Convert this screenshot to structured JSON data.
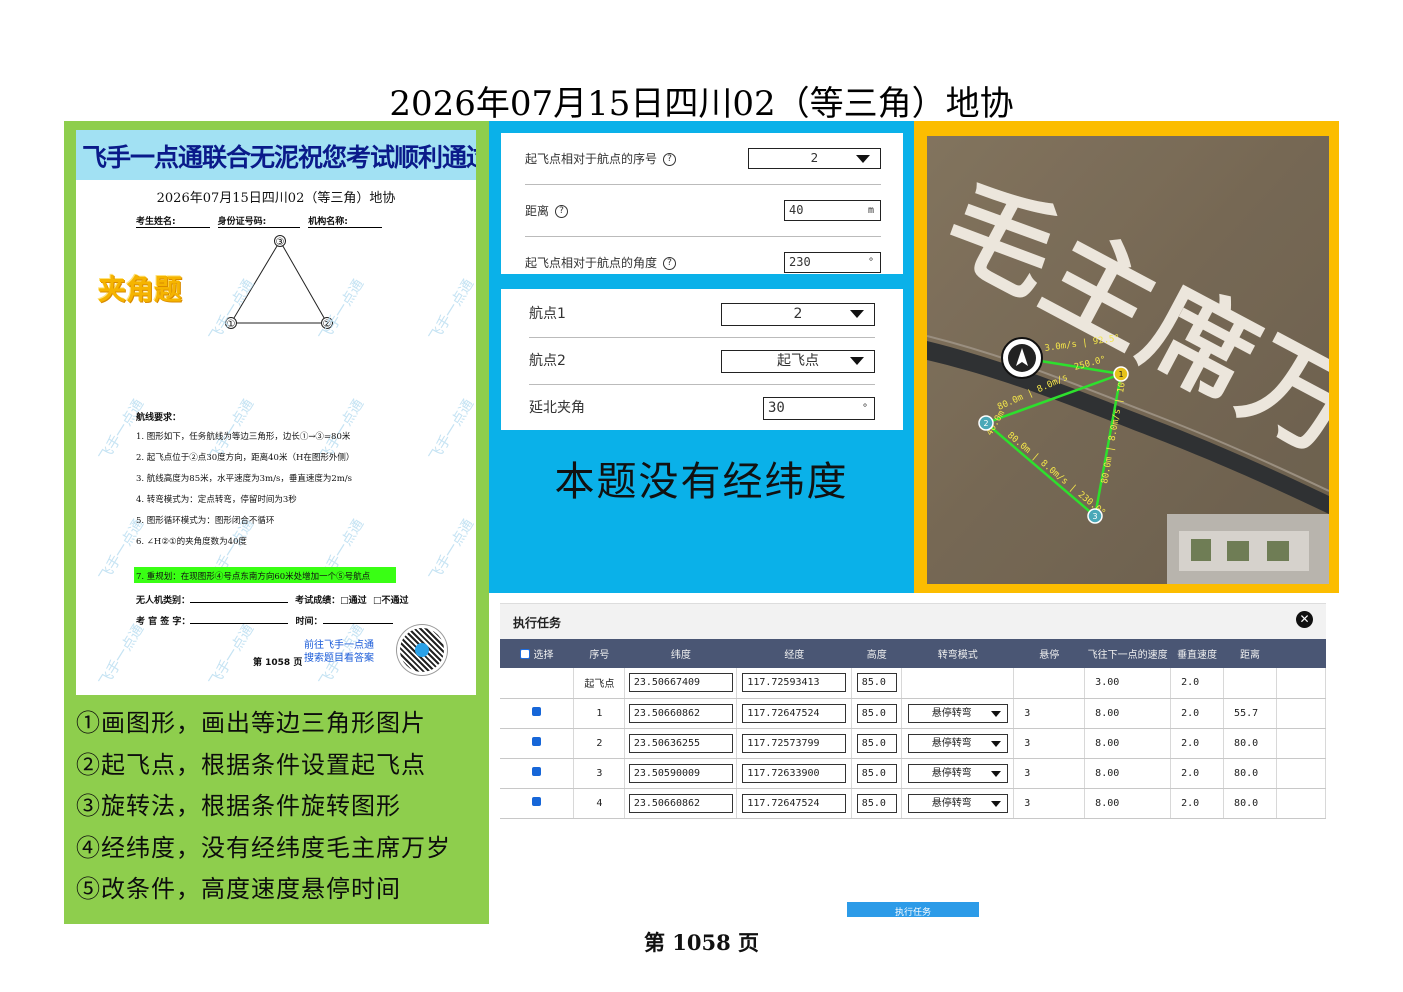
{
  "title": "2026年07月15日四川02（等三角）地协",
  "paper": {
    "banner": "飞手一点通联合无泥祝您考试顺利通过",
    "title": "2026年07月15日四川02（等三角）地协",
    "field_name": "考生姓名:",
    "field_id": "身份证号码:",
    "field_org": "机构名称:",
    "stamp": "夹角题",
    "tri_labels": [
      "③",
      "①",
      "②"
    ],
    "req_head": "航线要求：",
    "req": [
      "1.  图形如下，任务航线为等边三角形，边长①→③=80米",
      "2.  起飞点位于②点30度方向，距离40米（H在图形外侧）",
      "3.  航线高度为85米，水平速度为3m/s，垂直速度为2m/s",
      "4.  转弯模式为：定点转弯，停留时间为3秒",
      "5.  图形循环模式为：图形闭合不循环",
      "6.  ∠H②①的夹角度数为40度"
    ],
    "req_hl": "7.  重规划：在现图形④号点东南方向60米处增加一个⑤号航点",
    "uav_type": "无人机类别：",
    "result": "考试成绩：",
    "pass": "□通过",
    "fail": "□不通过",
    "examiner": "考 官 签 字：",
    "time": "时间：",
    "page": "第 1058 页",
    "goto1": "前往飞手一点通",
    "goto2": "搜索题目看答案",
    "watermark": "飞手一点通"
  },
  "steps": [
    "①画图形，画出等边三角形图片",
    "②起飞点，根据条件设置起飞点",
    "③旋转法，根据条件旋转图形",
    "④经纬度，没有经纬度毛主席万岁",
    "⑤改条件，高度速度悬停时间"
  ],
  "form1": {
    "seq_label": "起飞点相对于航点的序号",
    "seq_value": "2",
    "dist_label": "距离",
    "dist_value": "40",
    "dist_unit": "m",
    "angle_label": "起飞点相对于航点的角度",
    "angle_value": "230",
    "angle_unit": "°",
    "help": "?"
  },
  "form2": {
    "wp1_label": "航点1",
    "wp1_value": "2",
    "wp2_label": "航点2",
    "wp2_value": "起飞点",
    "north_label": "延北夹角",
    "north_value": "30",
    "north_unit": "°"
  },
  "no_latlon": "本题没有经纬度",
  "map": {
    "text": "毛主席万岁",
    "label_top": "3.0m/s | 92.5°",
    "label_a": "250.0°",
    "label_b": "80.0m | 8.0m/s",
    "label_c": "80.0m | 8.0m/s | 230.0°",
    "label_d": "40.0m",
    "label_e": "80.0m | 8.0m/s | 10.0°",
    "wp": [
      "1",
      "2",
      "3"
    ]
  },
  "task": {
    "title": "执行任务",
    "close": "✕",
    "headers": [
      "选择",
      "序号",
      "纬度",
      "经度",
      "高度",
      "转弯模式",
      "悬停",
      "飞往下一点的速度",
      "垂直速度",
      "距离"
    ],
    "rows": [
      {
        "seq": "起飞点",
        "lat": "23.50667409",
        "lon": "117.72593413",
        "alt": "85.0",
        "turn": "",
        "hover": "",
        "speed": "3.00",
        "vspeed": "2.0",
        "dist": ""
      },
      {
        "seq": "1",
        "lat": "23.50660862",
        "lon": "117.72647524",
        "alt": "85.0",
        "turn": "悬停转弯",
        "hover": "3",
        "speed": "8.00",
        "vspeed": "2.0",
        "dist": "55.7"
      },
      {
        "seq": "2",
        "lat": "23.50636255",
        "lon": "117.72573799",
        "alt": "85.0",
        "turn": "悬停转弯",
        "hover": "3",
        "speed": "8.00",
        "vspeed": "2.0",
        "dist": "80.0"
      },
      {
        "seq": "3",
        "lat": "23.50590009",
        "lon": "117.72633900",
        "alt": "85.0",
        "turn": "悬停转弯",
        "hover": "3",
        "speed": "8.00",
        "vspeed": "2.0",
        "dist": "80.0"
      },
      {
        "seq": "4",
        "lat": "23.50660862",
        "lon": "117.72647524",
        "alt": "85.0",
        "turn": "悬停转弯",
        "hover": "3",
        "speed": "8.00",
        "vspeed": "2.0",
        "dist": "80.0"
      }
    ],
    "exec": "执行任务"
  },
  "page_num": "第 1058 页"
}
